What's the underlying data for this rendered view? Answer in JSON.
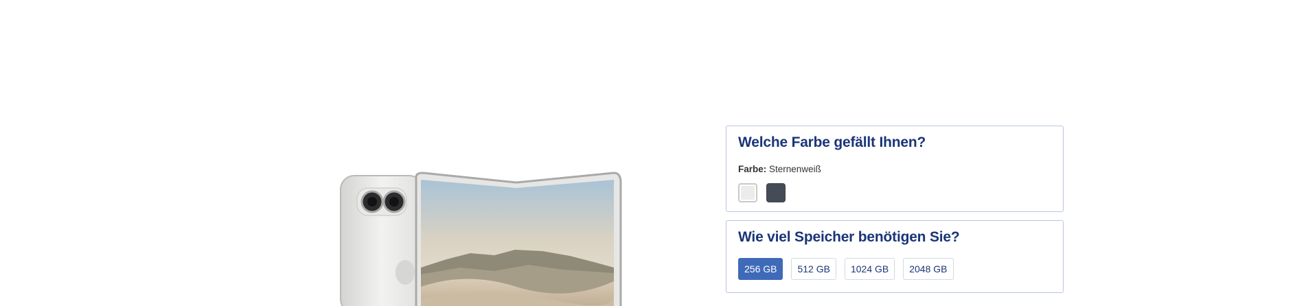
{
  "color_section": {
    "title": "Welche Farbe gefällt Ihnen?",
    "label": "Farbe:",
    "selected_value": "Sternenweiß",
    "swatches": [
      {
        "name": "Sternenweiß",
        "color": "#ececec",
        "selected": true
      },
      {
        "name": "dark",
        "color": "#454c58",
        "selected": false
      }
    ]
  },
  "storage_section": {
    "title": "Wie viel Speicher benötigen Sie?",
    "options": [
      {
        "label": "256 GB",
        "selected": true
      },
      {
        "label": "512 GB",
        "selected": false
      },
      {
        "label": "1024 GB",
        "selected": false
      },
      {
        "label": "2048 GB",
        "selected": false
      }
    ]
  },
  "colors": {
    "accent": "#3f6ab8",
    "title": "#1a3577",
    "border": "#b8c6de"
  }
}
